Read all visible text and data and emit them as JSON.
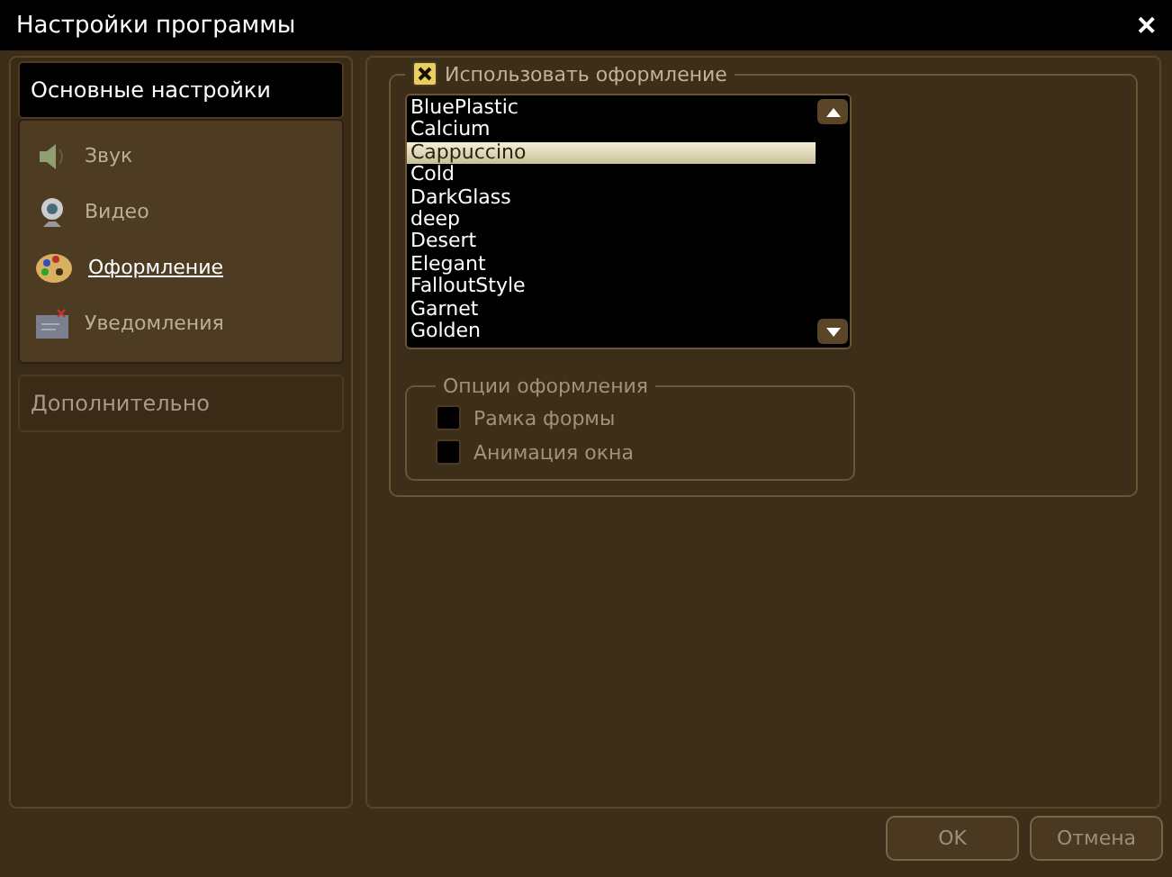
{
  "window": {
    "title": "Настройки программы",
    "close": "✕"
  },
  "sidebar": {
    "sections": [
      {
        "title": "Основные настройки",
        "expanded": true,
        "items": [
          {
            "label": "Звук",
            "selected": false
          },
          {
            "label": "Видео",
            "selected": false
          },
          {
            "label": "Оформление",
            "selected": true
          },
          {
            "label": "Уведомления",
            "selected": false
          }
        ]
      },
      {
        "title": "Дополнительно",
        "expanded": false
      }
    ]
  },
  "skin": {
    "label": "Использовать оформление",
    "checked": true,
    "items": [
      {
        "label": "BluePlastic",
        "selected": false
      },
      {
        "label": "Calcium",
        "selected": false
      },
      {
        "label": "Cappuccino",
        "selected": true
      },
      {
        "label": "Cold",
        "selected": false
      },
      {
        "label": "DarkGlass",
        "selected": false
      },
      {
        "label": "deep",
        "selected": false
      },
      {
        "label": "Desert",
        "selected": false
      },
      {
        "label": "Elegant",
        "selected": false
      },
      {
        "label": "FalloutStyle",
        "selected": false
      },
      {
        "label": "Garnet",
        "selected": false
      },
      {
        "label": "Golden",
        "selected": false
      }
    ]
  },
  "options": {
    "title": "Опции оформления",
    "disabled": true,
    "items": [
      {
        "label": "Рамка формы",
        "checked": false
      },
      {
        "label": "Анимация окна",
        "checked": false
      }
    ]
  },
  "buttons": [
    {
      "label": "OK"
    },
    {
      "label": "Отмена"
    }
  ]
}
